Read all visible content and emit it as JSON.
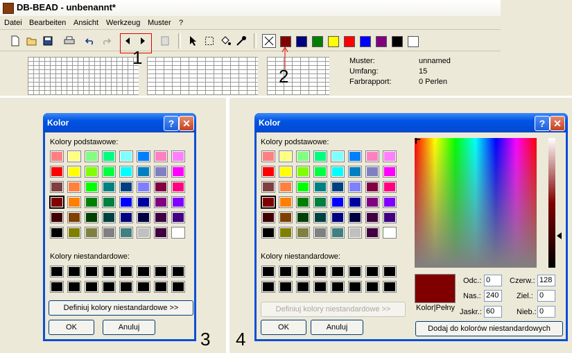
{
  "app": {
    "title": "DB-BEAD - unbenannt*",
    "menu": [
      "Datei",
      "Bearbeiten",
      "Ansicht",
      "Werkzeug",
      "Muster",
      "?"
    ],
    "palette": [
      "#800000",
      "#000080",
      "#008000",
      "#ffff00",
      "#ff0000",
      "#0000ff",
      "#800080",
      "#000000",
      "#ffffff"
    ],
    "info": {
      "labels": [
        "Muster:",
        "Umfang:",
        "Farbrapport:"
      ],
      "values": [
        "unnamed",
        "15",
        "0 Perlen"
      ]
    },
    "markers": {
      "one": "1",
      "two": "2"
    }
  },
  "dialog3": {
    "title": "Kolor",
    "basic_label": "Kolory podstawowe:",
    "custom_label": "Kolory niestandardowe:",
    "define_button": "Definiuj kolory niestandardowe >>",
    "ok": "OK",
    "cancel": "Anuluj",
    "number": "3"
  },
  "dialog4": {
    "title": "Kolor",
    "basic_label": "Kolory podstawowe:",
    "custom_label": "Kolory niestandardowe:",
    "define_button": "Definiuj kolory niestandardowe >>",
    "ok": "OK",
    "cancel": "Anuluj",
    "preview_label": "Kolor|Pełny",
    "hue_label": "Odc.:",
    "hue": "0",
    "sat_label": "Nas.:",
    "sat": "240",
    "lum_label": "Jaskr.:",
    "lum": "60",
    "red_label": "Czerw.:",
    "red": "128",
    "green_label": "Ziel.:",
    "green": "0",
    "blue_label": "Nieb.:",
    "blue": "0",
    "add_button": "Dodaj do kolorów niestandardowych",
    "number": "4",
    "selected_color": "#800000"
  },
  "basic_colors": [
    [
      "#ff8080",
      "#ffff80",
      "#80ff80",
      "#00ff80",
      "#80ffff",
      "#0080ff",
      "#ff80c0",
      "#ff80ff"
    ],
    [
      "#ff0000",
      "#ffff00",
      "#80ff00",
      "#00ff40",
      "#00ffff",
      "#0080c0",
      "#8080c0",
      "#ff00ff"
    ],
    [
      "#804040",
      "#ff8040",
      "#00ff00",
      "#008080",
      "#004080",
      "#8080ff",
      "#800040",
      "#ff0080"
    ],
    [
      "#800000",
      "#ff8000",
      "#008000",
      "#008040",
      "#0000ff",
      "#0000a0",
      "#800080",
      "#8000ff"
    ],
    [
      "#400000",
      "#804000",
      "#004000",
      "#004040",
      "#000080",
      "#000040",
      "#400040",
      "#400080"
    ],
    [
      "#000000",
      "#808000",
      "#808040",
      "#808080",
      "#408080",
      "#c0c0c0",
      "#400040",
      "#ffffff"
    ]
  ]
}
